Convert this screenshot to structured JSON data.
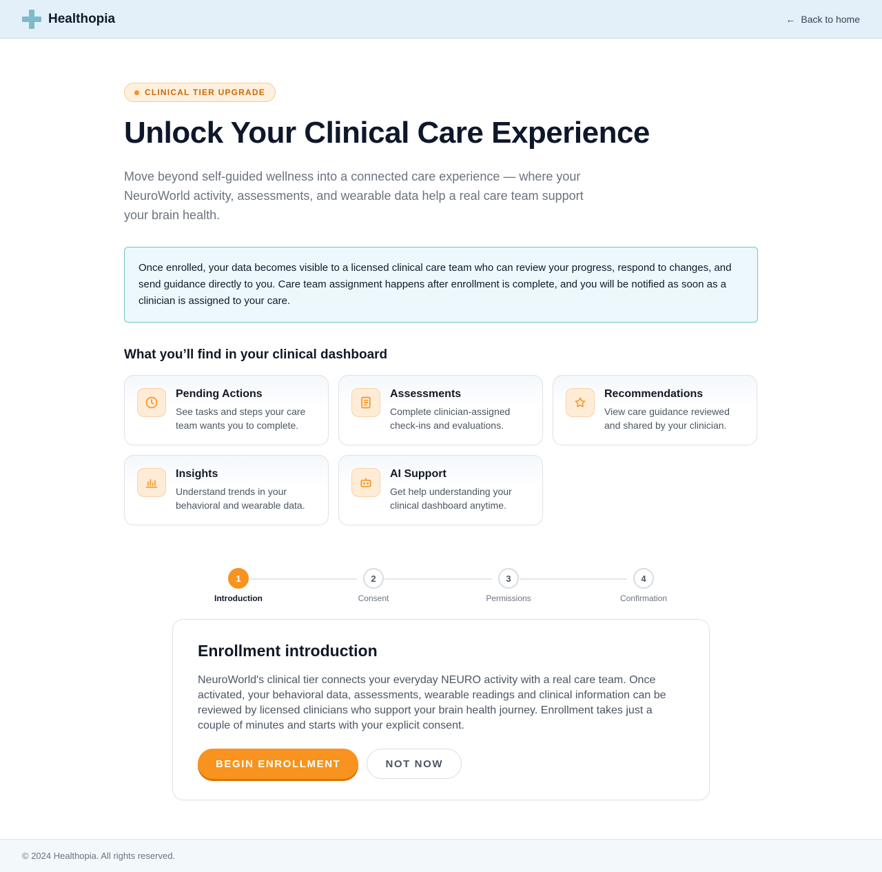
{
  "header": {
    "brand": "Healthopia",
    "back_arrow": "←",
    "back_label": "Back to home"
  },
  "hero": {
    "badge": "CLINICAL TIER UPGRADE",
    "title": "Unlock Your Clinical Care Experience",
    "subtitle": "Move beyond self-guided wellness into a connected care experience — where your NeuroWorld activity, assessments, and wearable data help a real care team support your brain health."
  },
  "notice": "Once enrolled, your data becomes visible to a licensed clinical care team who can review your progress, respond to changes, and send guidance directly to you. Care team assignment happens after enrollment is complete, and you will be notified as soon as a clinician is assigned to your care.",
  "dashboard": {
    "title": "What you’ll find in your clinical dashboard",
    "cards": [
      {
        "icon": "clock-icon",
        "title": "Pending Actions",
        "desc": "See tasks and steps your care team wants you to complete."
      },
      {
        "icon": "document-icon",
        "title": "Assessments",
        "desc": "Complete clinician-assigned check-ins and evaluations."
      },
      {
        "icon": "star-icon",
        "title": "Recommendations",
        "desc": "View care guidance reviewed and shared by your clinician."
      },
      {
        "icon": "bar-chart-icon",
        "title": "Insights",
        "desc": "Understand trends in your behavioral and wearable data."
      },
      {
        "icon": "robot-icon",
        "title": "AI Support",
        "desc": "Get help understanding your clinical dashboard anytime."
      }
    ]
  },
  "stepper": {
    "current": 1,
    "steps": [
      {
        "number": "1",
        "label": "Introduction"
      },
      {
        "number": "2",
        "label": "Consent"
      },
      {
        "number": "3",
        "label": "Permissions"
      },
      {
        "number": "4",
        "label": "Confirmation"
      }
    ]
  },
  "enrollment": {
    "title": "Enrollment introduction",
    "text": "NeuroWorld's clinical tier connects your everyday NEURO activity with a real care team. Once activated, your behavioral data, assessments, wearable readings and clinical information can be reviewed by licensed clinicians who support your brain health journey. Enrollment takes just a couple of minutes and starts with your explicit consent.",
    "primary_label": "BEGIN ENROLLMENT",
    "secondary_label": "NOT NOW"
  },
  "footer": {
    "copyright": "© 2024 Healthopia. All rights reserved."
  },
  "colors": {
    "accent": "#f7931e",
    "header_bg": "#e3f0fa",
    "notice_bg": "#ecf8fc",
    "notice_border": "#6ec6c4",
    "logo": "#7cbcc8"
  }
}
